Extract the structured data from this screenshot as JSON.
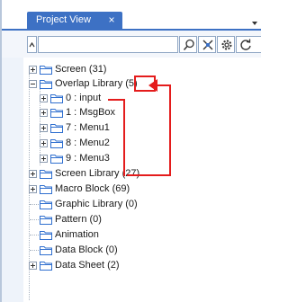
{
  "tab": {
    "title": "Project View",
    "close": "×"
  },
  "toolbar": {
    "search_value": "",
    "buttons": [
      "search-icon",
      "filter-icon",
      "settings-icon",
      "refresh-icon"
    ]
  },
  "tree": [
    {
      "label": "Screen (31)",
      "expander": "plus"
    },
    {
      "label": "Overlap Library (5)",
      "expander": "minus"
    },
    {
      "label": "0 : input",
      "expander": "plus"
    },
    {
      "label": "1 : MsgBox",
      "expander": "plus"
    },
    {
      "label": "7 : Menu1",
      "expander": "plus"
    },
    {
      "label": "8 : Menu2",
      "expander": "plus"
    },
    {
      "label": "9 : Menu3",
      "expander": "plus"
    },
    {
      "label": "Screen Library (27)",
      "expander": "plus"
    },
    {
      "label": "Macro Block (69)",
      "expander": "plus"
    },
    {
      "label": "Graphic Library (0)",
      "expander": "none"
    },
    {
      "label": "Pattern (0)",
      "expander": "none"
    },
    {
      "label": "Animation",
      "expander": "none"
    },
    {
      "label": "Data Block (0)",
      "expander": "none"
    },
    {
      "label": "Data Sheet (2)",
      "expander": "plus"
    }
  ],
  "colors": {
    "accent": "#3d71c4",
    "annotation": "#e41c1c",
    "folder": "#2f6fcf"
  }
}
